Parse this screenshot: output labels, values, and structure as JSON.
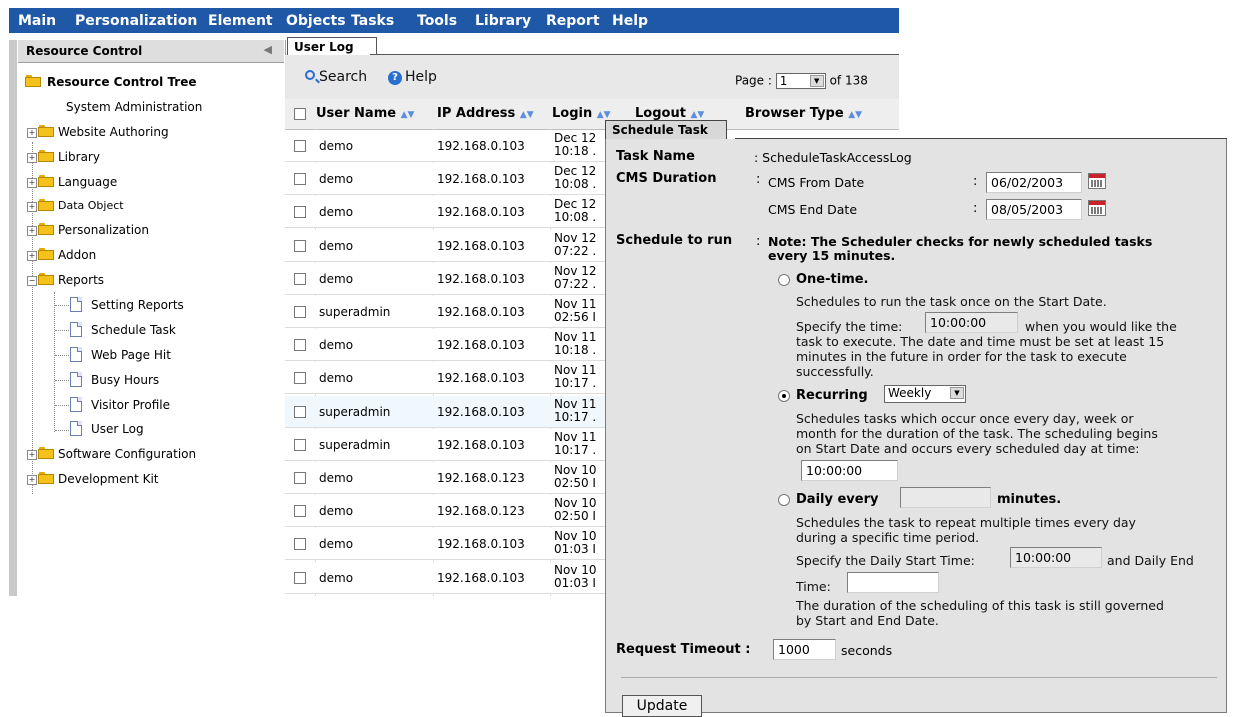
{
  "menu": [
    "Main",
    "Personalization",
    "Element",
    "Objects",
    "Tasks",
    "Tools",
    "Library",
    "Report",
    "Help"
  ],
  "left_panel": {
    "title": "Resource Control",
    "collapse_icon": "chevron-left-icon",
    "tree": [
      {
        "label": "Resource Control Tree",
        "type": "root-folder"
      },
      {
        "label": "System Administration",
        "type": "text"
      },
      {
        "label": "Website Authoring",
        "type": "folder",
        "state": "collapsed"
      },
      {
        "label": "Library",
        "type": "folder",
        "state": "collapsed"
      },
      {
        "label": "Language",
        "type": "folder",
        "state": "collapsed"
      },
      {
        "label": "Data Object",
        "type": "folder",
        "state": "collapsed"
      },
      {
        "label": "Personalization",
        "type": "folder",
        "state": "collapsed"
      },
      {
        "label": "Addon",
        "type": "folder",
        "state": "collapsed"
      },
      {
        "label": "Reports",
        "type": "folder",
        "state": "expanded"
      },
      {
        "label": "Setting Reports",
        "type": "page"
      },
      {
        "label": "Schedule Task",
        "type": "page"
      },
      {
        "label": "Web Page Hit",
        "type": "page"
      },
      {
        "label": "Busy Hours",
        "type": "page"
      },
      {
        "label": "Visitor Profile",
        "type": "page"
      },
      {
        "label": "User Log",
        "type": "page"
      },
      {
        "label": "Software Configuration",
        "type": "folder",
        "state": "collapsed"
      },
      {
        "label": "Development Kit",
        "type": "folder",
        "state": "collapsed"
      }
    ]
  },
  "user_log": {
    "tab": "User Log",
    "search_label": "Search",
    "help_label": "Help",
    "page_label": "Page :",
    "page_value": "1",
    "page_total": "of 138",
    "columns": [
      "User Name",
      "IP Address",
      "Login",
      "Logout",
      "Browser Type"
    ],
    "sort_glyph": "▲▼",
    "rows": [
      {
        "user": "demo",
        "ip": "192.168.0.103",
        "login1": "Dec 12",
        "login2": "10:18 ."
      },
      {
        "user": "demo",
        "ip": "192.168.0.103",
        "login1": "Dec 12",
        "login2": "10:08 ."
      },
      {
        "user": "demo",
        "ip": "192.168.0.103",
        "login1": "Dec 12",
        "login2": "10:08 ."
      },
      {
        "user": "demo",
        "ip": "192.168.0.103",
        "login1": "Nov 12",
        "login2": "07:22 ."
      },
      {
        "user": "demo",
        "ip": "192.168.0.103",
        "login1": "Nov 12",
        "login2": "07:22 ."
      },
      {
        "user": "superadmin",
        "ip": "192.168.0.103",
        "login1": "Nov 11",
        "login2": "02:56 I"
      },
      {
        "user": "demo",
        "ip": "192.168.0.103",
        "login1": "Nov 11",
        "login2": "10:18 ."
      },
      {
        "user": "demo",
        "ip": "192.168.0.103",
        "login1": "Nov 11",
        "login2": "10:17 ."
      },
      {
        "user": "superadmin",
        "ip": "192.168.0.103",
        "login1": "Nov 11",
        "login2": "10:17 ."
      },
      {
        "user": "superadmin",
        "ip": "192.168.0.103",
        "login1": "Nov 11",
        "login2": "10:17 ."
      },
      {
        "user": "demo",
        "ip": "192.168.0.123",
        "login1": "Nov 10",
        "login2": "02:50 I"
      },
      {
        "user": "demo",
        "ip": "192.168.0.123",
        "login1": "Nov 10",
        "login2": "02:50 I"
      },
      {
        "user": "demo",
        "ip": "192.168.0.103",
        "login1": "Nov 10",
        "login2": "01:03 I"
      },
      {
        "user": "demo",
        "ip": "192.168.0.103",
        "login1": "Nov 10",
        "login2": "01:03 I"
      }
    ]
  },
  "schedule": {
    "tab": "Schedule Task",
    "task_name_label": "Task Name",
    "task_name_value": ": ScheduleTaskAccessLog",
    "cms_duration_label": "CMS Duration",
    "colon": ":",
    "cms_from_label": "CMS From Date",
    "cms_from_value": "06/02/2003",
    "cms_end_label": "CMS End Date",
    "cms_end_value": "08/05/2003",
    "schedule_label": "Schedule to run",
    "note_line1": "Note: The Scheduler checks for newly scheduled tasks",
    "note_line2": "every 15 minutes.",
    "onetime_label": "One-time.",
    "onetime_desc": "Schedules to run the task once on the Start Date.",
    "specify_time_label": "Specify the time:",
    "specify_time_value": "10:00:00",
    "specify_time_suffix": "when you would like the",
    "onetime_desc2_l1": "task to execute. The date and time must be set at least 15",
    "onetime_desc2_l2": "minutes in the future in order for the task to execute",
    "onetime_desc2_l3": "successfully.",
    "recurring_label": "Recurring",
    "recurring_value": "Weekly",
    "recurring_desc_l1": "Schedules tasks which occur once every day, week or",
    "recurring_desc_l2": "month for the duration of the task. The scheduling begins",
    "recurring_desc_l3": "on Start Date and occurs every scheduled day at time:",
    "recurring_time": "10:00:00",
    "daily_label": "Daily every",
    "daily_value": "",
    "daily_suffix": "minutes.",
    "daily_desc_l1": "Schedules the task to repeat multiple times every day",
    "daily_desc_l2": "during a specific time period.",
    "daily_start_label": "Specify the Daily Start Time:",
    "daily_start_value": "10:00:00",
    "daily_end_label": "and Daily End",
    "time_label": "Time:",
    "daily_end_value": "",
    "governed_l1": "The duration of the scheduling of this task is still governed",
    "governed_l2": "by Start and End Date.",
    "request_timeout_label": "Request Timeout :",
    "request_timeout_value": "1000",
    "seconds_label": "seconds",
    "update_label": "Update",
    "selected_option": "recurring"
  },
  "colors": {
    "menu_bg": "#1f58a7",
    "panel_bg": "#e3e3e3",
    "accent": "#2a6ed0"
  }
}
